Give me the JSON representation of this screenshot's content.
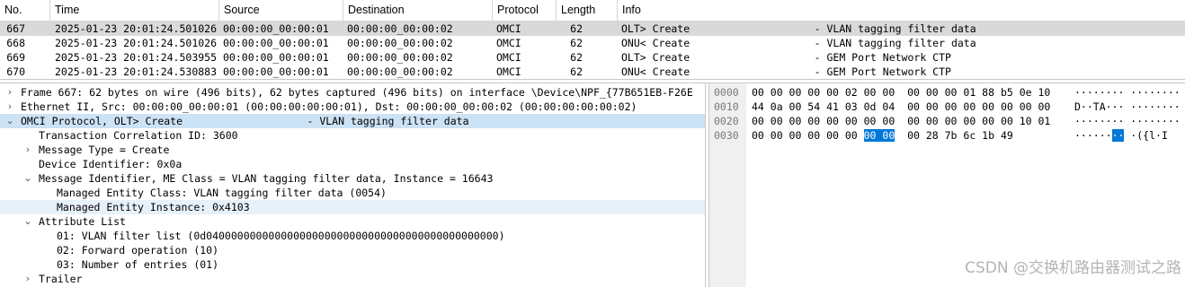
{
  "packet_list": {
    "columns": [
      "No.",
      "Time",
      "Source",
      "Destination",
      "Protocol",
      "Length",
      "Info"
    ],
    "rows": [
      {
        "no": "667",
        "time": "2025-01-23 20:01:24.501026",
        "src": "00:00:00_00:00:01",
        "dst": "00:00:00_00:00:02",
        "proto": "OMCI",
        "len": "62",
        "info": "OLT> Create                    - VLAN tagging filter data",
        "selected": true
      },
      {
        "no": "668",
        "time": "2025-01-23 20:01:24.501026",
        "src": "00:00:00_00:00:01",
        "dst": "00:00:00_00:00:02",
        "proto": "OMCI",
        "len": "62",
        "info": "ONU< Create                    - VLAN tagging filter data",
        "selected": false
      },
      {
        "no": "669",
        "time": "2025-01-23 20:01:24.503955",
        "src": "00:00:00_00:00:01",
        "dst": "00:00:00_00:00:02",
        "proto": "OMCI",
        "len": "62",
        "info": "OLT> Create                    - GEM Port Network CTP",
        "selected": false
      },
      {
        "no": "670",
        "time": "2025-01-23 20:01:24.530883",
        "src": "00:00:00_00:00:01",
        "dst": "00:00:00_00:00:02",
        "proto": "OMCI",
        "len": "62",
        "info": "ONU< Create                    - GEM Port Network CTP",
        "selected": false
      }
    ]
  },
  "details": [
    {
      "text": "Frame 667: 62 bytes on wire (496 bits), 62 bytes captured (496 bits) on interface \\Device\\NPF_{77B651EB-F26E",
      "arrow": "›",
      "indent": 0,
      "sel": ""
    },
    {
      "text": "Ethernet II, Src: 00:00:00_00:00:01 (00:00:00:00:00:01), Dst: 00:00:00_00:00:02 (00:00:00:00:00:02)",
      "arrow": "›",
      "indent": 0,
      "sel": ""
    },
    {
      "text": "OMCI Protocol, OLT> Create                    - VLAN tagging filter data",
      "arrow": "⌄",
      "indent": 0,
      "sel": "sel1"
    },
    {
      "text": "Transaction Correlation ID: 3600",
      "arrow": "",
      "indent": 1,
      "sel": ""
    },
    {
      "text": "Message Type = Create",
      "arrow": "›",
      "indent": 1,
      "sel": ""
    },
    {
      "text": "Device Identifier: 0x0a",
      "arrow": "",
      "indent": 1,
      "sel": ""
    },
    {
      "text": "Message Identifier, ME Class = VLAN tagging filter data, Instance = 16643",
      "arrow": "⌄",
      "indent": 1,
      "sel": ""
    },
    {
      "text": "Managed Entity Class: VLAN tagging filter data (0054)",
      "arrow": "",
      "indent": 2,
      "sel": ""
    },
    {
      "text": "Managed Entity Instance: 0x4103",
      "arrow": "",
      "indent": 2,
      "sel": "sel2"
    },
    {
      "text": "Attribute List",
      "arrow": "⌄",
      "indent": 1,
      "sel": ""
    },
    {
      "text": "01: VLAN filter list (0d04000000000000000000000000000000000000000000000)",
      "arrow": "",
      "indent": 2,
      "sel": ""
    },
    {
      "text": "02: Forward operation (10)",
      "arrow": "",
      "indent": 2,
      "sel": ""
    },
    {
      "text": "03: Number of entries (01)",
      "arrow": "",
      "indent": 2,
      "sel": ""
    },
    {
      "text": "Trailer",
      "arrow": "›",
      "indent": 1,
      "sel": ""
    }
  ],
  "bytes": [
    {
      "offset": "0000",
      "hex_a": "00 00 00 00 00 02 00 00  00 00 00 01 88 b5 0e 10",
      "hex_hl": "",
      "hex_b": "",
      "ascii_a": "········ ········",
      "ascii_hl": "",
      "ascii_b": ""
    },
    {
      "offset": "0010",
      "hex_a": "44 0a 00 54 41 03 0d 04  00 00 00 00 00 00 00 00",
      "hex_hl": "",
      "hex_b": "",
      "ascii_a": "D··TA··· ········",
      "ascii_hl": "",
      "ascii_b": ""
    },
    {
      "offset": "0020",
      "hex_a": "00 00 00 00 00 00 00 00  00 00 00 00 00 00 10 01",
      "hex_hl": "",
      "hex_b": "",
      "ascii_a": "········ ········",
      "ascii_hl": "",
      "ascii_b": ""
    },
    {
      "offset": "0030",
      "hex_a": "00 00 00 00 00 00 ",
      "hex_hl": "00 00",
      "hex_b": "  00 28 7b 6c 1b 49",
      "ascii_a": "······",
      "ascii_hl": "··",
      "ascii_b": " ·({l·I"
    }
  ],
  "watermark": "CSDN @交换机路由器测试之路"
}
